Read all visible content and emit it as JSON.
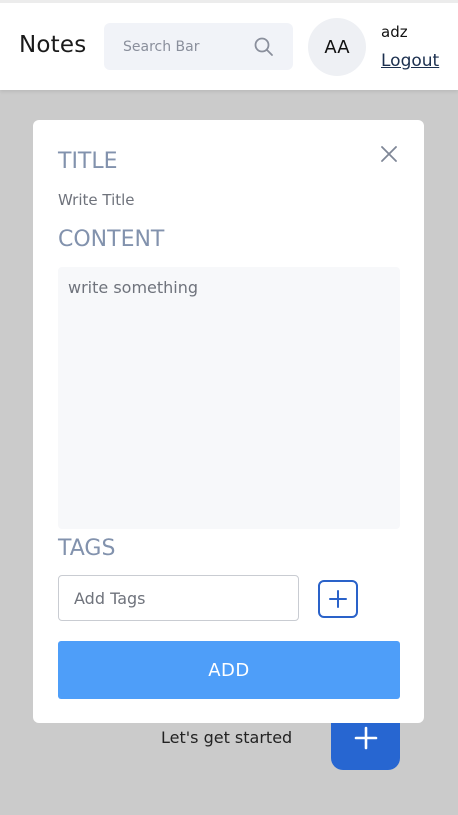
{
  "header": {
    "app_title": "Notes",
    "search_placeholder": "Search Bar",
    "avatar_initials": "AA",
    "username": "adz",
    "logout_label": "Logout"
  },
  "modal": {
    "title_label": "TITLE",
    "title_placeholder": "Write Title",
    "content_label": "CONTENT",
    "content_placeholder": "write something",
    "tags_label": "TAGS",
    "tags_placeholder": "Add Tags",
    "add_button_label": "ADD",
    "icons": {
      "close": "close-icon",
      "add_tag": "plus-icon"
    }
  },
  "background": {
    "get_started_text": "Let's get started",
    "fab_icon": "plus-icon"
  },
  "colors": {
    "accent": "#4e9ef9",
    "primary": "#2766d1",
    "label": "#8292ad",
    "overlay": "#cbcbcb"
  }
}
